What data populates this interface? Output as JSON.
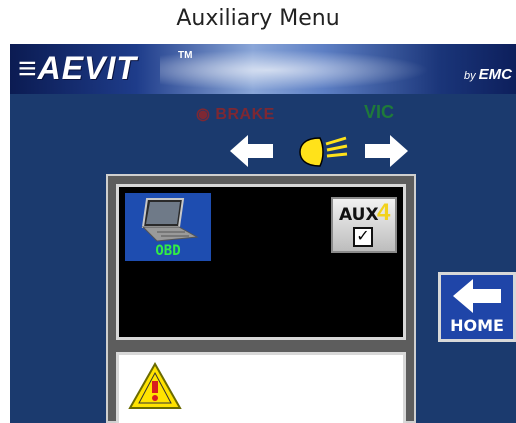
{
  "page": {
    "title": "Auxiliary Menu"
  },
  "banner": {
    "logo": "≡AEVIT",
    "tm": "TM",
    "by": "by",
    "brand": "EMC"
  },
  "indicators": {
    "brake": "◉ BRAKE",
    "vic": "VIC"
  },
  "icons": {
    "left_arrow": "arrow-left-icon",
    "right_arrow": "arrow-right-icon",
    "headlight": "headlight-icon",
    "laptop": "laptop-icon",
    "warning": "warning-icon",
    "home_arrow": "arrow-left-icon"
  },
  "panel": {
    "obd_button": {
      "label": "OBD"
    },
    "aux_button": {
      "label": "AUX",
      "number": "4",
      "checked": true,
      "check_glyph": "✓"
    }
  },
  "home_button": {
    "label": "HOME"
  },
  "colors": {
    "screen_bg": "#1b3a6e",
    "brake_text": "#7d2833",
    "vic_text": "#1f7a3a",
    "button_blue": "#1f45a8",
    "obd_text": "#33ee44",
    "aux_number": "#f2d21e",
    "headlight_yellow": "#ffe21a",
    "warning_yellow": "#ffe300",
    "warning_red": "#d81e1e"
  }
}
